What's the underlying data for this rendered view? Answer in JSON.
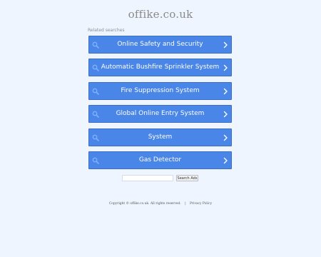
{
  "site": {
    "domain": "offike.co.uk"
  },
  "related": {
    "heading": "Related searches",
    "items": [
      {
        "label": "Online Safety and Security"
      },
      {
        "label": "Automatic Bushfire Sprinkler System"
      },
      {
        "label": "Fire Suppression System"
      },
      {
        "label": "Global Online Entry System"
      },
      {
        "label": "System"
      },
      {
        "label": "Gas Detector"
      }
    ]
  },
  "search": {
    "value": "",
    "button_label": "Search Ads"
  },
  "footer": {
    "copyright": "Copyright © offike.co.uk.  All rights reserved.",
    "separator": "|",
    "privacy_label": "Privacy Policy"
  },
  "colors": {
    "background": "#eef5fe",
    "result_button": "#4a86e8",
    "result_text": "#ffffff"
  },
  "icons": {
    "result_left": "search-icon",
    "result_right": "chevron-right-icon"
  }
}
